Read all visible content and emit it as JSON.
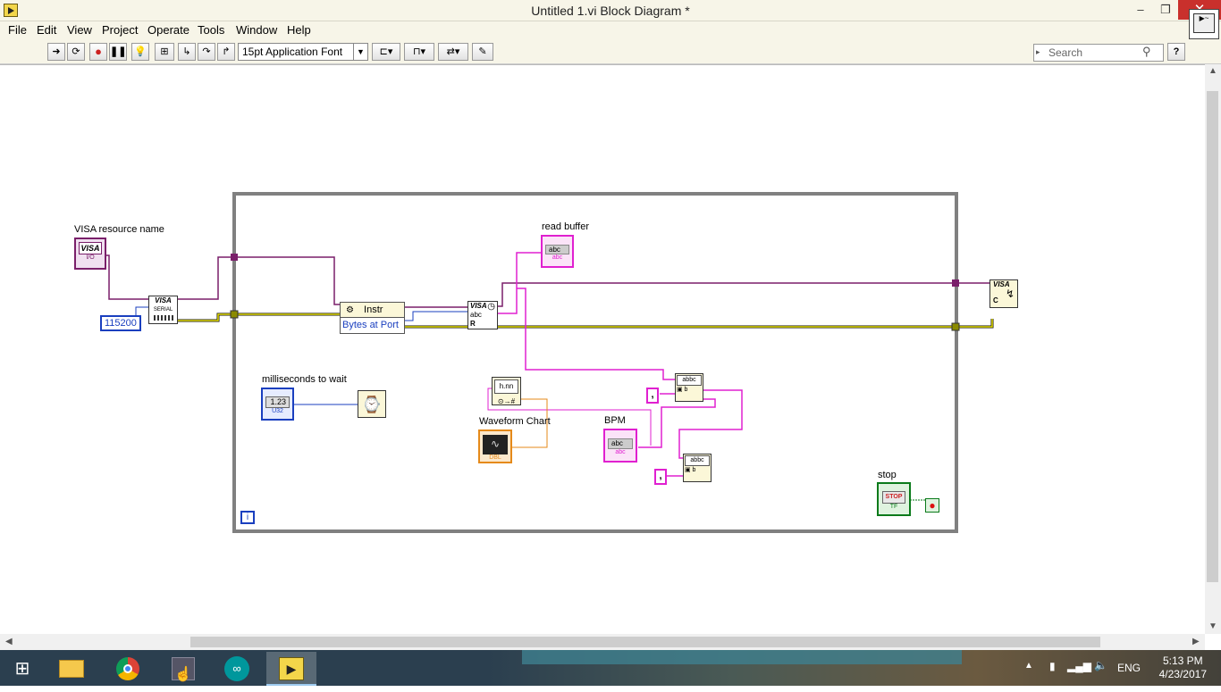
{
  "window": {
    "title": "Untitled 1.vi Block Diagram *",
    "controls": {
      "minimize": "–",
      "restore": "❐",
      "close": "✕"
    }
  },
  "menu": [
    "File",
    "Edit",
    "View",
    "Project",
    "Operate",
    "Tools",
    "Window",
    "Help"
  ],
  "toolbar": {
    "font": "15pt Application Font",
    "search_placeholder": "Search",
    "help": "?"
  },
  "diagram": {
    "colors": {
      "visa": "#7a1f6a",
      "string": "#e020d0",
      "error": "#8b8b00",
      "numeric_i32": "#1a3fbf",
      "numeric_dbl": "#e58a1a",
      "bool": "#0a7a1a",
      "loop": "#808080"
    },
    "labels": {
      "visa_resource": "VISA resource name",
      "read_buffer": "read buffer",
      "ms_wait": "milliseconds to wait",
      "waveform_chart": "Waveform Chart",
      "bpm": "BPM",
      "stop": "stop"
    },
    "constants": {
      "baud": "115200"
    },
    "nodes": {
      "property_class": "Instr",
      "property_item": "Bytes at Port",
      "visa_text": "VISA",
      "visa_sub": "I/O",
      "serial_sub": "SERIAL",
      "read_letter": "R",
      "close_letter": "C",
      "abc": "abc",
      "u32": "U32",
      "dbl": "DBL",
      "num_123": "1.23",
      "stop_text": "STOP",
      "tf": "TF",
      "iter": "i",
      "comma": ",",
      "scan_abbc": "abbc",
      "num_fmt": "h.nn"
    }
  },
  "taskbar": {
    "items": [
      "explorer",
      "chrome",
      "touch",
      "arduino",
      "labview"
    ],
    "language": "ENG",
    "time": "5:13 PM",
    "date": "4/23/2017"
  }
}
